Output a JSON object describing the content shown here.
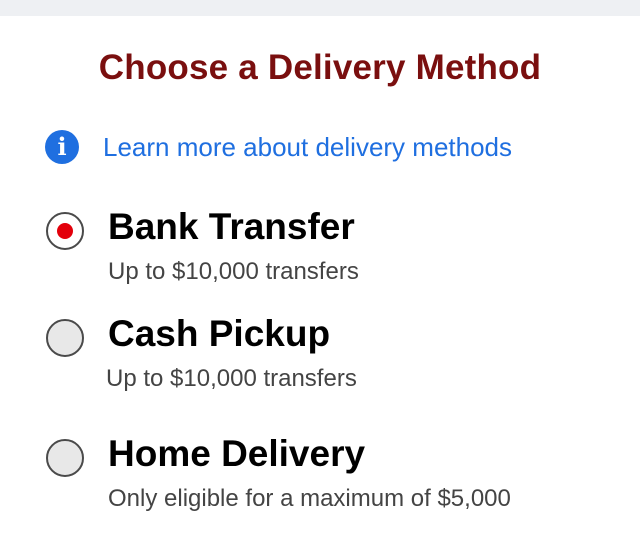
{
  "header": {
    "title": "Choose a Delivery Method"
  },
  "learn_more": {
    "icon": "info-icon",
    "icon_glyph": "i",
    "label": "Learn more about delivery methods",
    "color": "#1f6fe0"
  },
  "options": [
    {
      "label": "Bank Transfer",
      "description": "Up to $10,000 transfers",
      "selected": true
    },
    {
      "label": "Cash Pickup",
      "description": "Up to $10,000 transfers",
      "selected": false
    },
    {
      "label": "Home Delivery",
      "description": "Only eligible for a maximum of $5,000",
      "selected": false
    }
  ],
  "colors": {
    "title": "#7a0f0f",
    "selected_dot": "#e3000b",
    "link": "#1f6fe0"
  }
}
